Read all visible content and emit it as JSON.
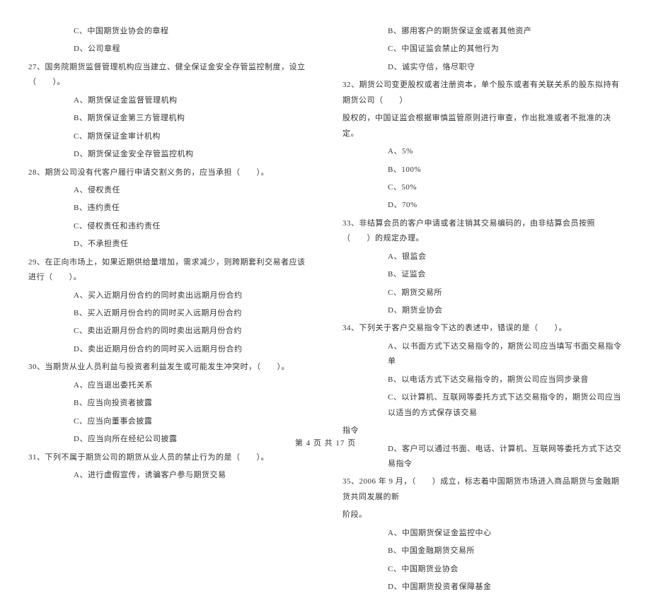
{
  "left": {
    "q26_opts_tail": [
      "C、中国期货业协会的章程",
      "D、公司章程"
    ],
    "q27": {
      "stem": "27、国务院期货监督管理机构应当建立、健全保证金安全存管监控制度，设立（　　）。",
      "opts": [
        "A、期货保证金监督管理机构",
        "B、期货保证金第三方管理机构",
        "C、期货保证金审计机构",
        "D、期货保证金安全存管监控机构"
      ]
    },
    "q28": {
      "stem": "28、期货公司没有代客户履行申请交割义务的，应当承担（　　）。",
      "opts": [
        "A、侵权责任",
        "B、违约责任",
        "C、侵权责任和违约责任",
        "D、不承担责任"
      ]
    },
    "q29": {
      "stem": "29、在正向市场上，如果近期供给量增加，需求减少，则跨期套利交易者应该进行（　　）。",
      "opts": [
        "A、买入近期月份合约的同时卖出远期月份合约",
        "B、买入近期月份合约的同时买入远期月份合约",
        "C、卖出近期月份合约的同时卖出远期月份合约",
        "D、卖出近期月份合约的同时买入远期月份合约"
      ]
    },
    "q30": {
      "stem": "30、当期货从业人员利益与投资者利益发生或可能发生冲突时，（　　）。",
      "opts": [
        "A、应当退出委托关系",
        "B、应当向投资者披露",
        "C、应当向董事会披露",
        "D、应当向所在经纪公司披露"
      ]
    },
    "q31": {
      "stem": "31、下列不属于期货公司的期货从业人员的禁止行为的是（　　）。",
      "opts_head": [
        "A、进行虚假宣传，诱骗客户参与期货交易"
      ]
    }
  },
  "right": {
    "q31_opts_tail": [
      "B、挪用客户的期货保证金或者其他资产",
      "C、中国证监会禁止的其他行为",
      "D、诚实守信，恪尽职守"
    ],
    "q32": {
      "stem": "32、期货公司变更股权或者注册资本，单个股东或者有关联关系的股东拟持有期货公司（　　）",
      "stem2": "股权的，中国证监会根据审慎监管原则进行审查，作出批准或者不批准的决定。",
      "opts": [
        "A、5%",
        "B、100%",
        "C、50%",
        "D、70%"
      ]
    },
    "q33": {
      "stem": "33、非结算会员的客户申请或者注销其交易编码的，由非结算会员按照（　　）的规定办理。",
      "opts": [
        "A、银监会",
        "B、证监会",
        "C、期货交易所",
        "D、期货业协会"
      ]
    },
    "q34": {
      "stem": "34、下列关于客户交易指令下达的表述中，错误的是（　　）。",
      "opts": [
        "A、以书面方式下达交易指令的，期货公司应当填写书面交易指令单",
        "B、以电话方式下达交易指令的，期货公司应当同步录音",
        "C、以计算机、互联网等委托方式下达交易指令的，期货公司应当以适当的方式保存该交易",
        "D、客户可以通过书面、电话、计算机、互联网等委托方式下达交易指令"
      ],
      "cont_c": "指令"
    },
    "q35": {
      "stem": "35、2006 年 9 月，（　　）成立，标志着中国期货市场进入商品期货与金融期货共同发展的新",
      "stem2": "阶段。",
      "opts": [
        "A、中国期货保证金监控中心",
        "B、中国金融期货交易所",
        "C、中国期货业协会",
        "D、中国期货投资者保障基金"
      ]
    }
  },
  "footer": "第 4 页 共 17 页"
}
